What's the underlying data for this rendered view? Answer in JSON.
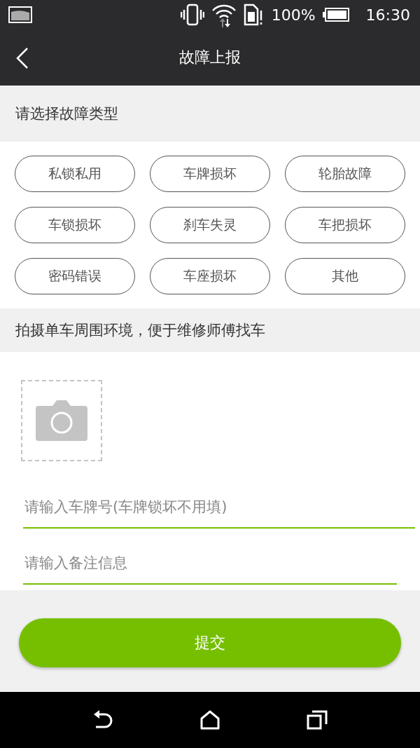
{
  "status_bar": {
    "battery": "100%",
    "time": "16:30"
  },
  "app_bar": {
    "title": "故障上报"
  },
  "fault_section": {
    "heading": "请选择故障类型",
    "types": [
      {
        "label": "私锁私用",
        "selected": false
      },
      {
        "label": "车牌损坏",
        "selected": false
      },
      {
        "label": "轮胎故障",
        "selected": false
      },
      {
        "label": "车锁损坏",
        "selected": false
      },
      {
        "label": "刹车失灵",
        "selected": false
      },
      {
        "label": "车把损坏",
        "selected": false
      },
      {
        "label": "密码错误",
        "selected": false
      },
      {
        "label": "车座损坏",
        "selected": false
      },
      {
        "label": "其他",
        "selected": false
      }
    ]
  },
  "photo_section": {
    "heading": "拍摄单车周围环境，便于维修师傅找车"
  },
  "fields": [
    {
      "placeholder": "请输入车牌号(车牌锁坏不用填)"
    },
    {
      "placeholder": "请输入备注信息"
    }
  ],
  "submit_button": "提交"
}
